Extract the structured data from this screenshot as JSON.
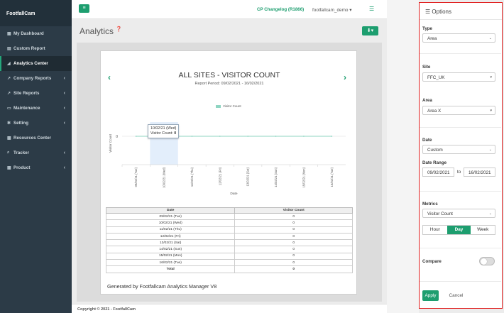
{
  "sidebar": {
    "brand": "FootfallCam",
    "items": [
      {
        "label": "My Dashboard",
        "icon": "dashboard-icon",
        "glyph": "▦",
        "arrow": false,
        "active": false
      },
      {
        "label": "Custom Report",
        "icon": "file-icon",
        "glyph": "▤",
        "arrow": false,
        "active": false
      },
      {
        "label": "Analytics Center",
        "icon": "chart-icon",
        "glyph": "◢",
        "arrow": false,
        "active": true
      },
      {
        "label": "Company Reports",
        "icon": "chart-line-icon",
        "glyph": "↗",
        "arrow": true,
        "active": false
      },
      {
        "label": "Site Reports",
        "icon": "chart-line-icon",
        "glyph": "↗",
        "arrow": true,
        "active": false
      },
      {
        "label": "Maintenance",
        "icon": "monitor-icon",
        "glyph": "▭",
        "arrow": true,
        "active": false
      },
      {
        "label": "Setting",
        "icon": "gear-icon",
        "glyph": "✱",
        "arrow": true,
        "active": false
      },
      {
        "label": "Resources Center",
        "icon": "book-icon",
        "glyph": "▩",
        "arrow": false,
        "active": false
      },
      {
        "label": "Tracker",
        "icon": "search-icon",
        "glyph": "⌕",
        "arrow": true,
        "active": false
      },
      {
        "label": "Product",
        "icon": "grid-icon",
        "glyph": "▦",
        "arrow": true,
        "active": false
      }
    ]
  },
  "topbar": {
    "menu_glyph": "≡",
    "changelog": "CP Changelog (R1866)",
    "user": "footfallcam_demo",
    "user_caret": "▾",
    "list_glyph": "☰"
  },
  "page": {
    "title": "Analytics",
    "help_glyph": "❓",
    "download_glyph": "⬇▾",
    "footer": "Copyright © 2021 - FootfallCam"
  },
  "report": {
    "title": "ALL SITES - VISITOR COUNT",
    "subtitle": "Report Period: 09/02/2021 - 16/02/2021",
    "prev_glyph": "‹",
    "next_glyph": "›",
    "tooltip_date": "10/02/21 (Wed)",
    "tooltip_metric": "Visitor Count:",
    "tooltip_value": "0",
    "table_headers": [
      "Date",
      "Visitor Count"
    ],
    "table_rows": [
      {
        "date": "09/02/21 (Tue)",
        "count": "0"
      },
      {
        "date": "10/02/21 (Wed)",
        "count": "0"
      },
      {
        "date": "11/02/21 (Thu)",
        "count": "0"
      },
      {
        "date": "12/02/21 (Fri)",
        "count": "0"
      },
      {
        "date": "13/02/21 (Sat)",
        "count": "0"
      },
      {
        "date": "14/02/21 (Sun)",
        "count": "0"
      },
      {
        "date": "15/02/21 (Mon)",
        "count": "0"
      },
      {
        "date": "16/02/21 (Tue)",
        "count": "0"
      }
    ],
    "total_label": "Total",
    "total_value": "0",
    "generated": "Generated by Footfallcam Analytics Manager V8"
  },
  "chart_data": {
    "type": "area",
    "title": "ALL SITES - VISITOR COUNT",
    "subtitle": "Report Period: 09/02/2021 - 16/02/2021",
    "xlabel": "Date",
    "ylabel": "Visitor Count",
    "yticks": [
      "0"
    ],
    "categories": [
      "09/02/21 (Tue)",
      "10/02/21 (Wed)",
      "11/02/21 (Thu)",
      "12/02/21 (Fri)",
      "13/02/21 (Sat)",
      "14/02/21 (Sun)",
      "15/02/21 (Mon)",
      "16/02/21 (Tue)"
    ],
    "series": [
      {
        "name": "Visitor Count",
        "values": [
          0,
          0,
          0,
          0,
          0,
          0,
          0,
          0
        ],
        "color": "#8fd5c2"
      }
    ],
    "highlight_index": 1,
    "legend": "top"
  },
  "options": {
    "header": "Options",
    "header_glyph": "☰",
    "type_label": "Type",
    "type_value": "Area",
    "site_label": "Site",
    "site_value": "FFC_UK",
    "area_label": "Area",
    "area_value": "Area X",
    "date_label": "Date",
    "date_value": "Custom",
    "range_label": "Date Range",
    "range_from": "09/02/2021",
    "range_to_label": "to",
    "range_to": "16/02/2021",
    "metrics_label": "Metrics",
    "metrics_value": "Visitor Count",
    "granularity": [
      "Hour",
      "Day",
      "Week"
    ],
    "granularity_selected": "Day",
    "compare_label": "Compare",
    "apply": "Apply",
    "cancel": "Cancel",
    "caret": "⌄",
    "caret_small": "▾"
  }
}
